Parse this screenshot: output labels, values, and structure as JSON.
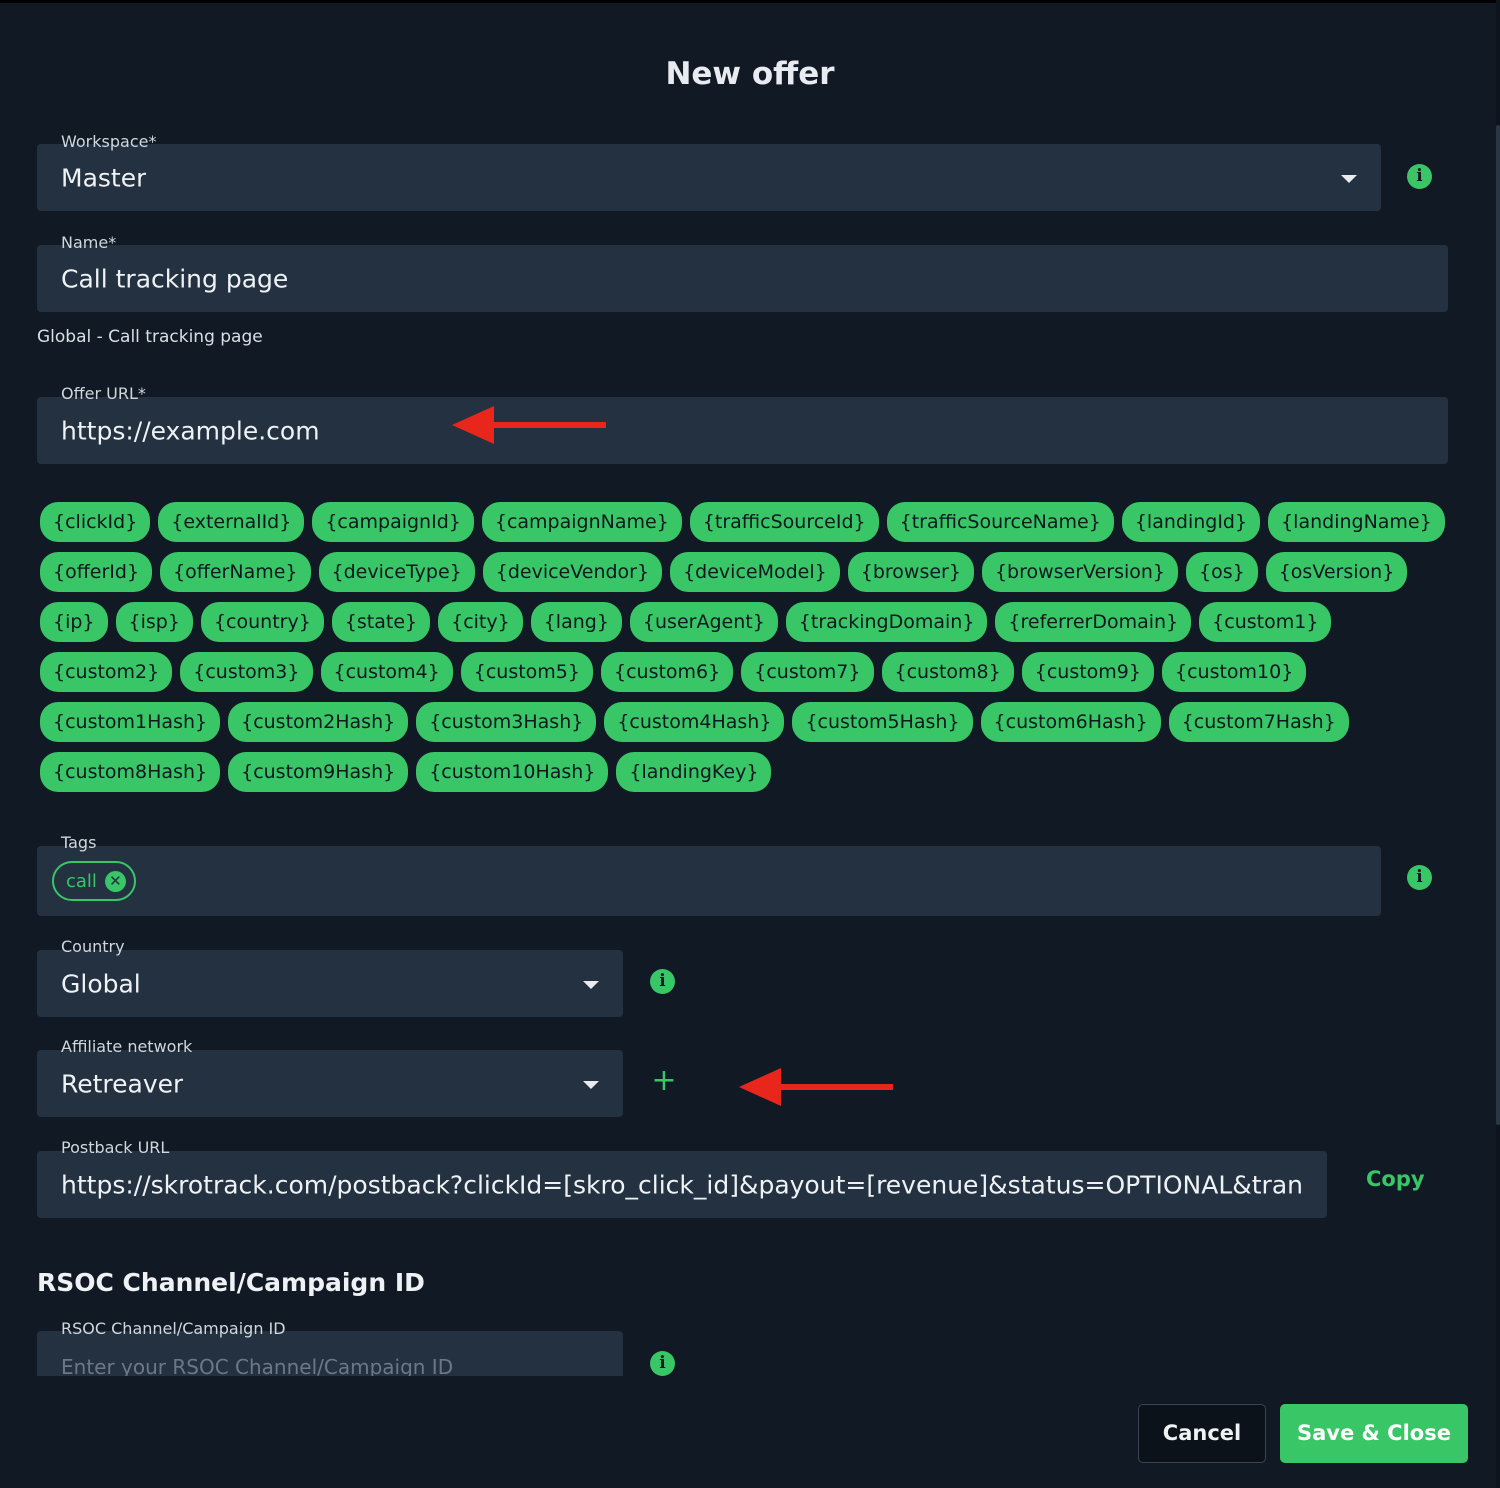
{
  "dialog": {
    "title": "New offer"
  },
  "workspace": {
    "label": "Workspace*",
    "value": "Master"
  },
  "name": {
    "label": "Name*",
    "value": "Call tracking page",
    "helper": "Global - Call tracking page"
  },
  "offer_url": {
    "label": "Offer URL*",
    "value": "https://example.com"
  },
  "tokens": [
    "{clickId}",
    "{externalId}",
    "{campaignId}",
    "{campaignName}",
    "{trafficSourceId}",
    "{trafficSourceName}",
    "{landingId}",
    "{landingName}",
    "{offerId}",
    "{offerName}",
    "{deviceType}",
    "{deviceVendor}",
    "{deviceModel}",
    "{browser}",
    "{browserVersion}",
    "{os}",
    "{osVersion}",
    "{ip}",
    "{isp}",
    "{country}",
    "{state}",
    "{city}",
    "{lang}",
    "{userAgent}",
    "{trackingDomain}",
    "{referrerDomain}",
    "{custom1}",
    "{custom2}",
    "{custom3}",
    "{custom4}",
    "{custom5}",
    "{custom6}",
    "{custom7}",
    "{custom8}",
    "{custom9}",
    "{custom10}",
    "{custom1Hash}",
    "{custom2Hash}",
    "{custom3Hash}",
    "{custom4Hash}",
    "{custom5Hash}",
    "{custom6Hash}",
    "{custom7Hash}",
    "{custom8Hash}",
    "{custom9Hash}",
    "{custom10Hash}",
    "{landingKey}"
  ],
  "tags": {
    "label": "Tags",
    "chips": [
      "call"
    ]
  },
  "country": {
    "label": "Country",
    "value": "Global"
  },
  "affiliate_network": {
    "label": "Affiliate network",
    "value": "Retreaver"
  },
  "postback": {
    "label": "Postback URL",
    "value": "https://skrotrack.com/postback?clickId=[skro_click_id]&payout=[revenue]&status=OPTIONAL&tran",
    "copy_label": "Copy"
  },
  "rsoc": {
    "section_title": "RSOC Channel/Campaign ID",
    "label": "RSOC Channel/Campaign ID",
    "placeholder": "Enter your RSOC Channel/Campaign ID"
  },
  "footer": {
    "cancel_label": "Cancel",
    "save_label": "Save & Close"
  },
  "colors": {
    "accent": "#38c667",
    "background": "#111a24",
    "field": "#233140",
    "annotation": "#e8261c"
  },
  "icons": {
    "info": "info-icon",
    "caret": "chevron-down-icon",
    "plus": "plus-icon",
    "chip_close": "close-circle-icon"
  }
}
